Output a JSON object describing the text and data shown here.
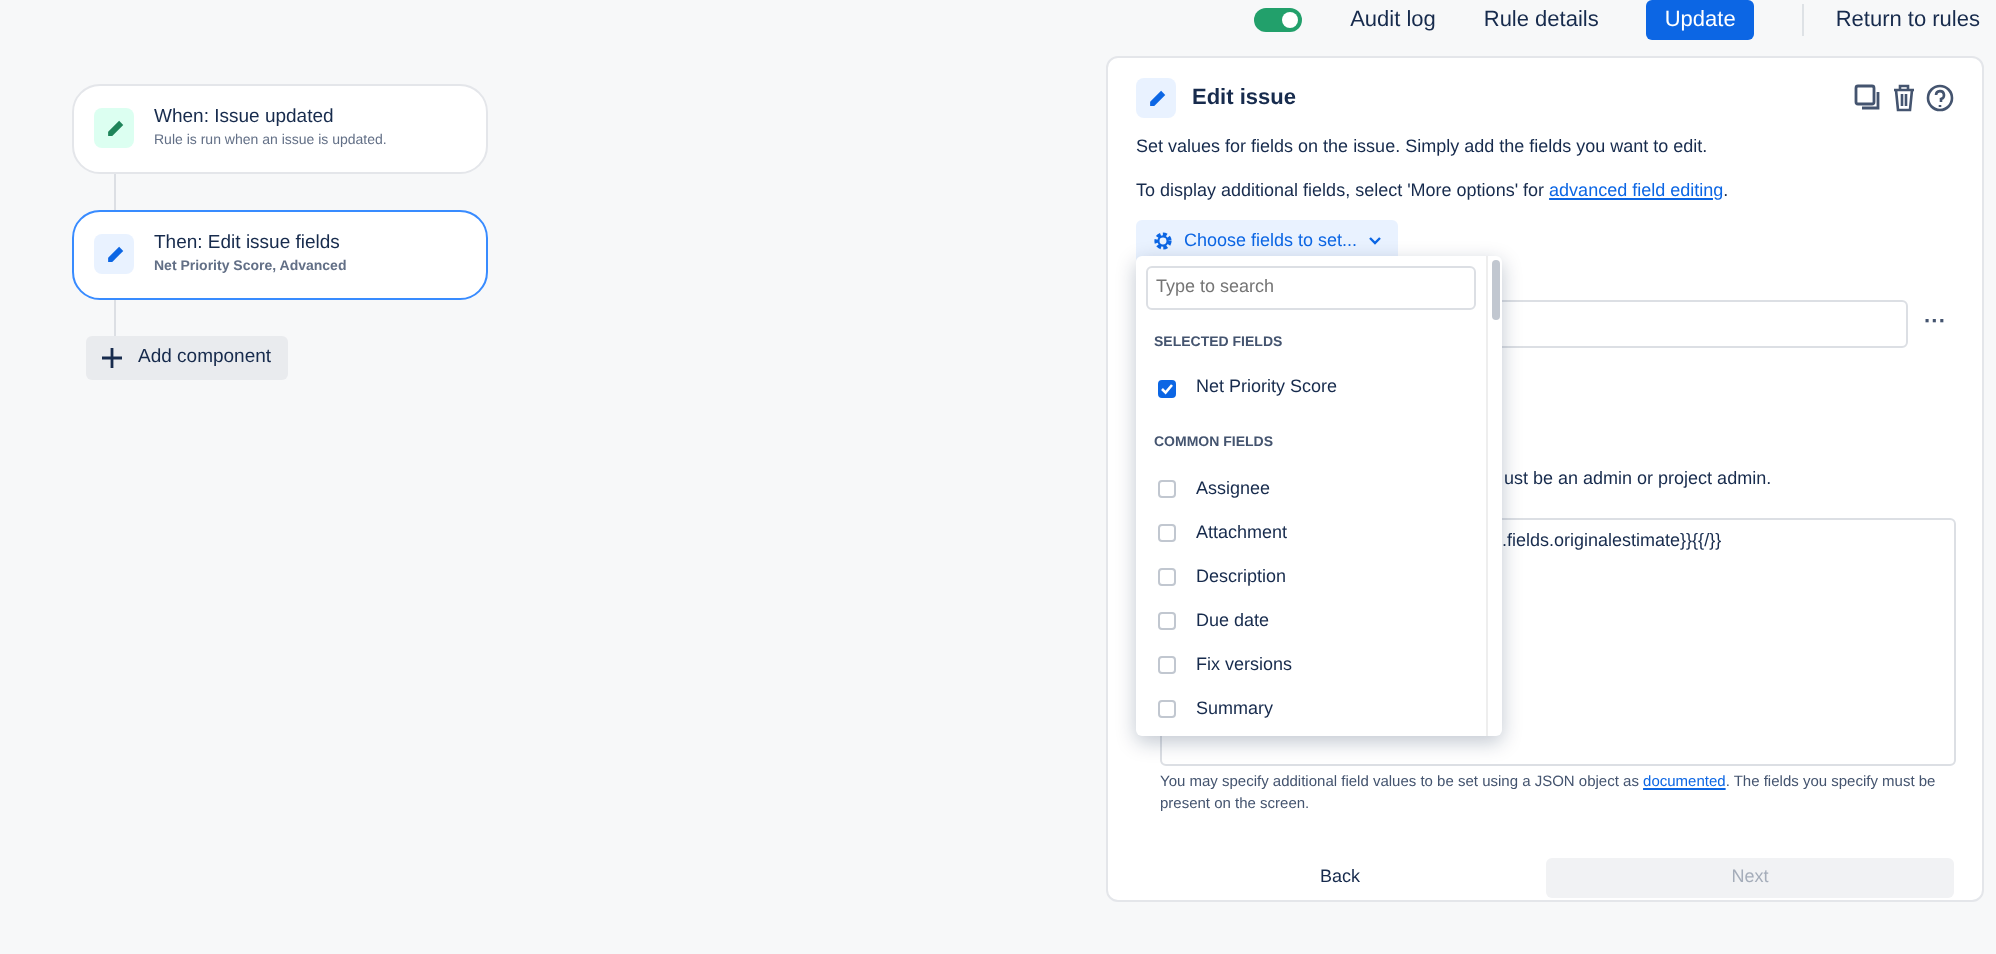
{
  "top_bar": {
    "toggle": {
      "on": true
    },
    "links": [
      "Audit log",
      "Rule details"
    ],
    "update_button": "Update",
    "return_link": "Return to rules"
  },
  "rule_nodes": [
    {
      "title": "When: Issue updated",
      "subtitle": "Rule is run when an issue is updated.",
      "kind": "trigger",
      "selected": false
    },
    {
      "title": "Then: Edit issue fields",
      "subtitle": "Net Priority Score, Advanced",
      "kind": "action",
      "selected": true
    }
  ],
  "add_component": "Add component",
  "panel": {
    "title": "Edit issue",
    "description": "Set values for fields on the issue. Simply add the fields you want to edit.",
    "hint": "To display additional fields, select 'More options' for ",
    "hint_link": "advanced field editing",
    "hint_end": ".",
    "choose_button": "Choose fields to set...",
    "more_button": "···",
    "admin_note": "ust be an admin or project admin.",
    "json_value": ".fields.originalestimate}}{{/}}",
    "json_help": "You may specify additional field values to be set using a JSON object as ",
    "json_help_link": "documented",
    "json_help_end": ". The fields you specify must be present on the screen.",
    "back_button": "Back",
    "next_button": "Next",
    "next_disabled": true
  },
  "dropdown": {
    "search_placeholder": "Type to search",
    "groups": [
      {
        "heading": "SELECTED FIELDS",
        "items": [
          {
            "label": "Net Priority Score",
            "checked": true
          }
        ]
      },
      {
        "heading": "COMMON FIELDS",
        "items": [
          {
            "label": "Assignee",
            "checked": false
          },
          {
            "label": "Attachment",
            "checked": false
          },
          {
            "label": "Description",
            "checked": false
          },
          {
            "label": "Due date",
            "checked": false
          },
          {
            "label": "Fix versions",
            "checked": false
          },
          {
            "label": "Summary",
            "checked": false
          }
        ]
      }
    ]
  }
}
